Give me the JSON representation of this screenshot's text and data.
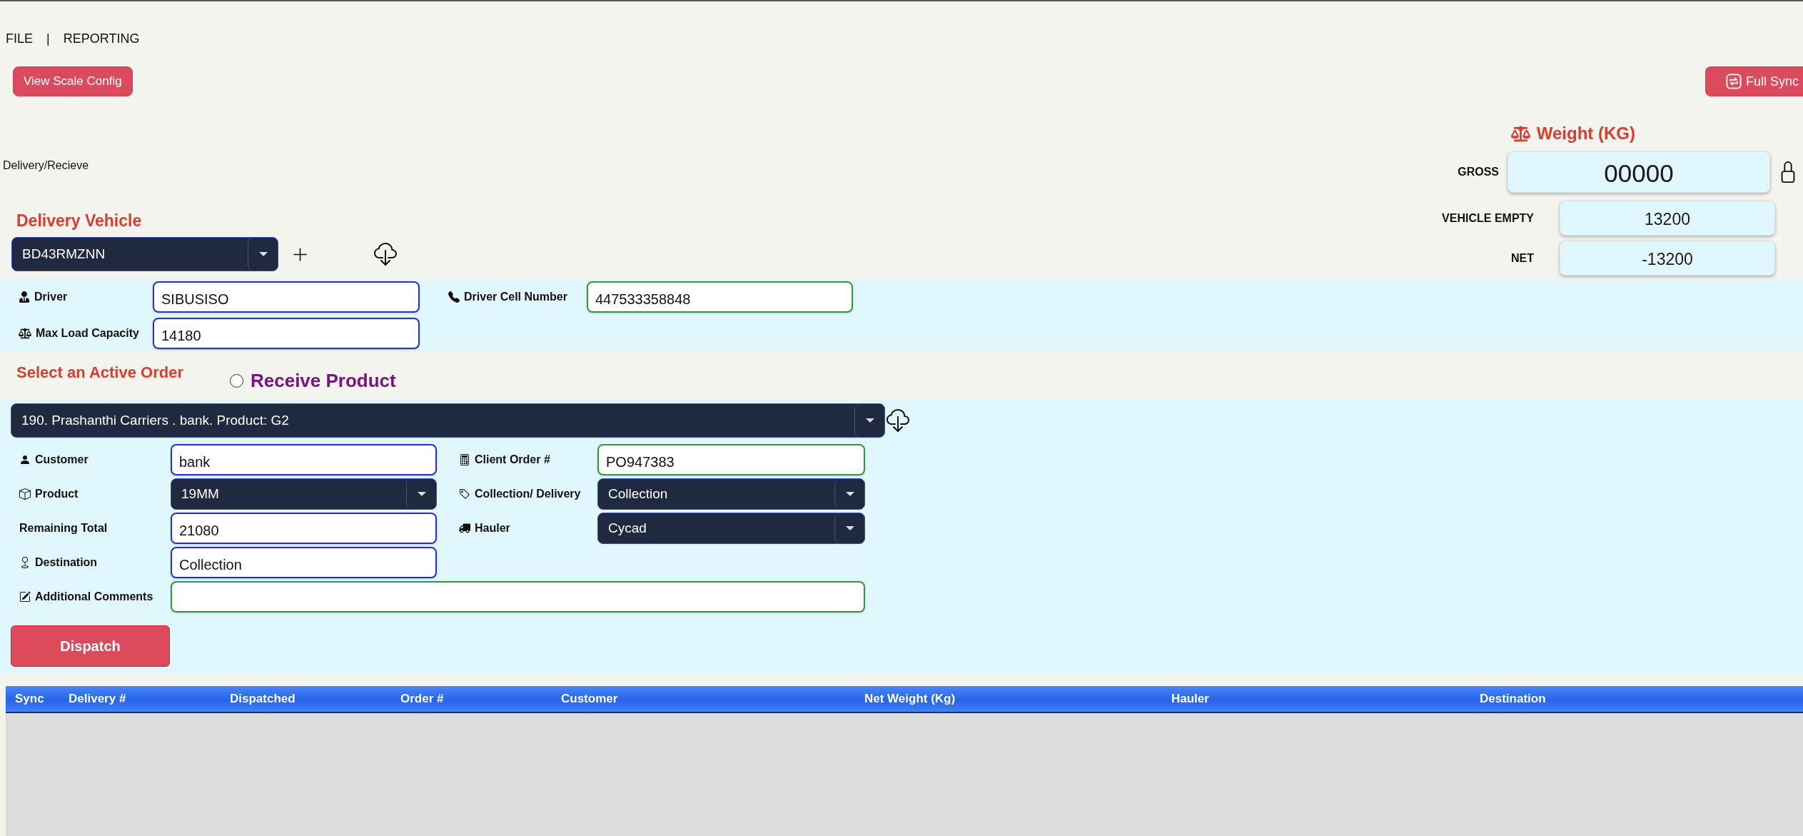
{
  "menu": {
    "items": [
      {
        "label": "FILE"
      },
      {
        "label": "REPORTING"
      }
    ],
    "separator": "|"
  },
  "toolbar": {
    "scale_config_button": "View Scale Config",
    "sync_button": "Full Sync"
  },
  "mode_label": "Delivery/Recieve",
  "weight": {
    "title": "Weight (KG)",
    "gross": {
      "label": "GROSS",
      "value": "00000"
    },
    "vehicle_empty": {
      "label": "VEHICLE EMPTY",
      "value": "13200"
    },
    "net": {
      "label": "NET",
      "value": "-13200"
    }
  },
  "vehicle": {
    "heading": "Delivery Vehicle",
    "value": "BD43RMZNN"
  },
  "driver": {
    "name": {
      "label": "Driver",
      "value": "SIBUSISO"
    },
    "max_load_capacity": {
      "label": "Max Load Capacity",
      "value": "14180"
    },
    "cell_number": {
      "label": "Driver Cell Number",
      "value": "447533358848"
    }
  },
  "order": {
    "heading": "Select an Active Order",
    "receive_product": {
      "label": "Receive Product",
      "selected": false
    },
    "value": "190. Prashanthi Carriers . bank. Product: G2",
    "customer": {
      "label": "Customer",
      "value": "bank"
    },
    "client_order_number": {
      "label": "Client Order #",
      "value": "PO947383"
    },
    "product": {
      "label": "Product",
      "value": "19MM"
    },
    "collection_delivery": {
      "label": "Collection/ Delivery",
      "value": "Collection"
    },
    "remaining_total": {
      "label": "Remaining Total",
      "value": "21080"
    },
    "hauler": {
      "label": "Hauler",
      "value": "Cycad"
    },
    "destination": {
      "label": "Destination",
      "value": "Collection"
    },
    "additional_comments": {
      "label": "Additional Comments"
    },
    "dispatch_button": "Dispatch"
  },
  "table": {
    "columns": [
      "Sync",
      "Delivery #",
      "Dispatched",
      "Order #",
      "Customer",
      "Net Weight (Kg)",
      "Hauler",
      "Destination"
    ]
  }
}
